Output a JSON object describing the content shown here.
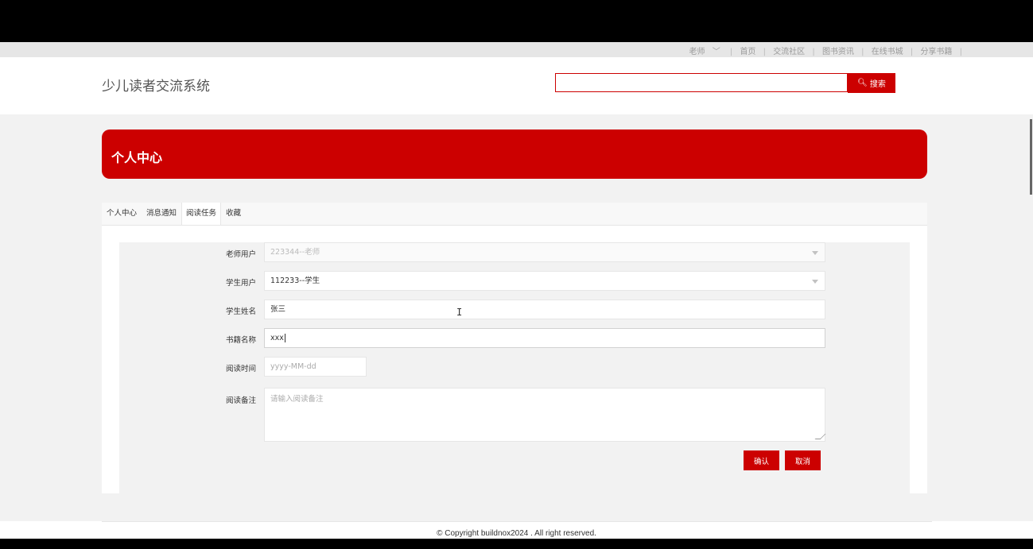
{
  "topnav": {
    "user_label": "老师",
    "links": [
      "首页",
      "交流社区",
      "图书资讯",
      "在线书城",
      "分享书籍"
    ]
  },
  "header": {
    "site_title": "少儿读者交流系统",
    "search_value": "",
    "search_button": "搜索"
  },
  "banner": {
    "title": "个人中心"
  },
  "tabs": [
    "个人中心",
    "消息通知",
    "阅读任务",
    "收藏"
  ],
  "active_tab": "阅读任务",
  "form": {
    "teacher_label": "老师用户",
    "teacher_value": "223344--老师",
    "student_label": "学生用户",
    "student_value": "112233--学生",
    "name_label": "学生姓名",
    "name_value": "张三",
    "book_label": "书籍名称",
    "book_value": "xxx",
    "date_label": "阅读时间",
    "date_placeholder": "yyyy-MM-dd",
    "note_label": "阅读备注",
    "note_placeholder": "请输入阅读备注",
    "confirm_button": "确认",
    "cancel_button": "取消"
  },
  "footer": {
    "copyright": "© Copyright buildnox2024 . All right reserved."
  },
  "colors": {
    "brand_red": "#cc0000"
  }
}
